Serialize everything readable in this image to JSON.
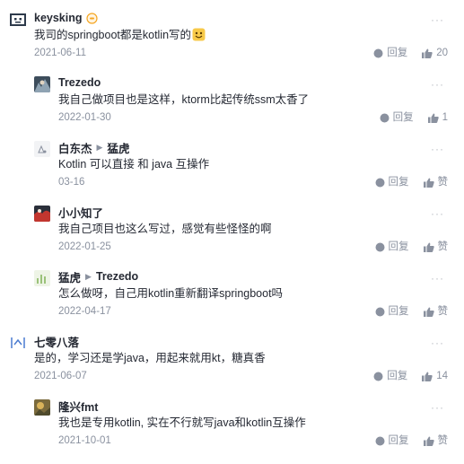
{
  "icons": {
    "reply": "comment-bubble-icon",
    "like": "thumbs-up-icon",
    "more": "more-dots-icon"
  },
  "reply_label": "回复",
  "like_default": "赞",
  "comments": [
    {
      "author": "keysking",
      "to": "",
      "content": "我司的springboot都是kotlin写的",
      "date": "2021-06-11",
      "likes": "20",
      "nested": false
    },
    {
      "author": "Trezedo",
      "to": "",
      "content": "我自己做项目也是这样，ktorm比起传统ssm太香了",
      "date": "2022-01-30",
      "likes": "1",
      "nested": true
    },
    {
      "author": "白东杰",
      "to": "猛虎",
      "content": "Kotlin 可以直接 和 java 互操作",
      "date": "03-16",
      "likes": "赞",
      "nested": true
    },
    {
      "author": "小小知了",
      "to": "",
      "content": "我自己项目也这么写过，感觉有些怪怪的啊",
      "date": "2022-01-25",
      "likes": "赞",
      "nested": true
    },
    {
      "author": "猛虎",
      "to": "Trezedo",
      "content": "怎么做呀，自己用kotlin重新翻译springboot吗",
      "date": "2022-04-17",
      "likes": "赞",
      "nested": true
    },
    {
      "author": "七零八落",
      "to": "",
      "content": "是的，学习还是学java，用起来就用kt，糖真香",
      "date": "2021-06-07",
      "likes": "14",
      "nested": false
    },
    {
      "author": "隆兴fmt",
      "to": "",
      "content": "我也是专用kotlin, 实在不行就写java和kotlin互操作",
      "date": "2021-10-01",
      "likes": "赞",
      "nested": true
    }
  ]
}
